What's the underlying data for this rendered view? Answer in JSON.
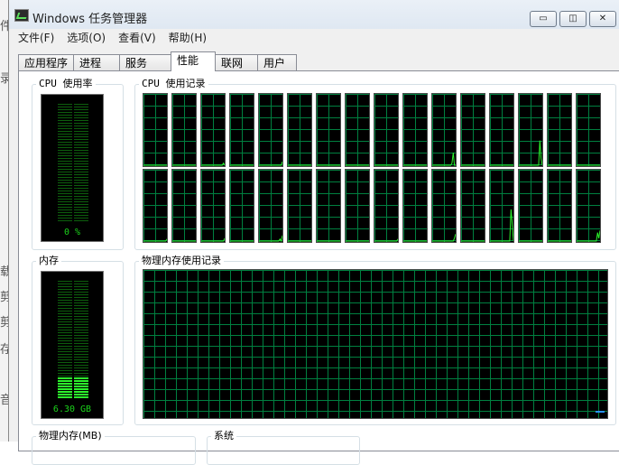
{
  "window": {
    "title": "Windows 任务管理器",
    "caption_buttons": {
      "minimize": "▭",
      "restore": "◫",
      "close": "✕"
    }
  },
  "menubar": {
    "items": [
      {
        "label": "文件(F)"
      },
      {
        "label": "选项(O)"
      },
      {
        "label": "查看(V)"
      },
      {
        "label": "帮助(H)"
      }
    ]
  },
  "tabs": [
    {
      "label": "应用程序",
      "active": false
    },
    {
      "label": "进程",
      "active": false
    },
    {
      "label": "服务",
      "active": false
    },
    {
      "label": "性能",
      "active": true
    },
    {
      "label": "联网",
      "active": false
    },
    {
      "label": "用户",
      "active": false
    }
  ],
  "performance": {
    "cpu_usage": {
      "label": "CPU 使用率",
      "value_text": "0 %",
      "level": 0.0
    },
    "cpu_history": {
      "label": "CPU 使用记录",
      "core_count": 16,
      "cores": [
        {
          "top": [
            0,
            0,
            0,
            0,
            0,
            0,
            0,
            0,
            0,
            0,
            0,
            0,
            0,
            0,
            0,
            0,
            0,
            0,
            0,
            0
          ],
          "bottom": [
            0,
            0,
            0,
            0,
            0,
            0,
            0,
            0,
            0,
            0,
            0,
            0,
            0,
            0,
            0,
            0,
            0,
            0,
            0,
            3
          ]
        },
        {
          "top": [
            0,
            0,
            0,
            0,
            0,
            0,
            0,
            0,
            0,
            0,
            0,
            0,
            0,
            0,
            0,
            0,
            0,
            0,
            0,
            0
          ],
          "bottom": [
            0,
            0,
            0,
            0,
            0,
            0,
            0,
            0,
            0,
            0,
            0,
            0,
            0,
            0,
            0,
            0,
            0,
            0,
            0,
            0
          ]
        },
        {
          "top": [
            0,
            0,
            0,
            0,
            0,
            0,
            0,
            0,
            0,
            0,
            0,
            0,
            0,
            0,
            0,
            0,
            0,
            0,
            3,
            0
          ],
          "bottom": [
            0,
            0,
            0,
            0,
            0,
            0,
            0,
            0,
            0,
            0,
            0,
            0,
            0,
            0,
            0,
            0,
            0,
            0,
            0,
            4
          ]
        },
        {
          "top": [
            0,
            0,
            0,
            0,
            0,
            0,
            0,
            0,
            0,
            0,
            0,
            0,
            0,
            0,
            0,
            0,
            0,
            0,
            0,
            0
          ],
          "bottom": [
            0,
            0,
            0,
            0,
            0,
            0,
            0,
            0,
            0,
            0,
            0,
            0,
            0,
            0,
            0,
            0,
            0,
            0,
            0,
            0
          ]
        },
        {
          "top": [
            0,
            0,
            0,
            0,
            0,
            0,
            0,
            0,
            0,
            0,
            0,
            0,
            0,
            0,
            0,
            0,
            0,
            0,
            0,
            5
          ],
          "bottom": [
            0,
            0,
            0,
            0,
            0,
            0,
            0,
            0,
            0,
            0,
            0,
            0,
            0,
            0,
            0,
            0,
            0,
            3,
            0,
            8
          ]
        },
        {
          "top": [
            0,
            0,
            0,
            0,
            0,
            0,
            0,
            0,
            0,
            0,
            0,
            0,
            0,
            0,
            0,
            0,
            0,
            0,
            0,
            0
          ],
          "bottom": [
            0,
            0,
            0,
            0,
            0,
            0,
            0,
            0,
            0,
            0,
            0,
            0,
            0,
            0,
            0,
            0,
            0,
            0,
            0,
            0
          ]
        },
        {
          "top": [
            0,
            0,
            0,
            0,
            0,
            0,
            0,
            0,
            0,
            0,
            0,
            0,
            0,
            0,
            0,
            0,
            0,
            0,
            0,
            0
          ],
          "bottom": [
            0,
            0,
            0,
            0,
            0,
            0,
            0,
            0,
            0,
            0,
            0,
            0,
            0,
            0,
            0,
            0,
            0,
            0,
            0,
            0
          ]
        },
        {
          "top": [
            0,
            0,
            0,
            0,
            0,
            0,
            0,
            0,
            0,
            0,
            0,
            0,
            0,
            0,
            0,
            0,
            0,
            0,
            0,
            0
          ],
          "bottom": [
            0,
            0,
            0,
            0,
            0,
            0,
            0,
            0,
            0,
            0,
            0,
            0,
            0,
            0,
            0,
            0,
            0,
            0,
            0,
            0
          ]
        },
        {
          "top": [
            0,
            0,
            0,
            0,
            0,
            0,
            0,
            0,
            0,
            0,
            0,
            0,
            0,
            0,
            0,
            0,
            0,
            0,
            0,
            0
          ],
          "bottom": [
            0,
            0,
            0,
            0,
            0,
            0,
            0,
            0,
            0,
            0,
            0,
            0,
            0,
            0,
            0,
            0,
            0,
            0,
            0,
            3
          ]
        },
        {
          "top": [
            0,
            0,
            0,
            0,
            0,
            0,
            0,
            0,
            0,
            0,
            0,
            0,
            0,
            0,
            0,
            0,
            0,
            0,
            0,
            0
          ],
          "bottom": [
            0,
            0,
            0,
            0,
            0,
            0,
            0,
            0,
            0,
            0,
            0,
            0,
            0,
            0,
            0,
            0,
            0,
            0,
            0,
            0
          ]
        },
        {
          "top": [
            0,
            0,
            0,
            0,
            0,
            0,
            0,
            0,
            0,
            0,
            0,
            0,
            0,
            0,
            0,
            0,
            3,
            18,
            0,
            0
          ],
          "bottom": [
            0,
            0,
            0,
            0,
            0,
            0,
            0,
            0,
            0,
            0,
            0,
            0,
            0,
            0,
            0,
            0,
            0,
            0,
            4,
            10
          ]
        },
        {
          "top": [
            0,
            0,
            0,
            0,
            0,
            0,
            0,
            0,
            0,
            0,
            0,
            0,
            0,
            0,
            0,
            0,
            0,
            0,
            0,
            0
          ],
          "bottom": [
            0,
            0,
            0,
            0,
            0,
            0,
            0,
            0,
            0,
            0,
            0,
            0,
            0,
            0,
            0,
            0,
            0,
            0,
            0,
            0
          ]
        },
        {
          "top": [
            0,
            0,
            0,
            0,
            0,
            0,
            0,
            0,
            0,
            0,
            0,
            0,
            0,
            0,
            0,
            0,
            0,
            0,
            0,
            0
          ],
          "bottom": [
            0,
            0,
            0,
            0,
            0,
            0,
            0,
            0,
            0,
            0,
            0,
            0,
            0,
            0,
            0,
            0,
            0,
            45,
            25,
            0
          ]
        },
        {
          "top": [
            0,
            0,
            0,
            0,
            0,
            0,
            0,
            0,
            0,
            0,
            0,
            0,
            0,
            0,
            0,
            0,
            0,
            35,
            10,
            0
          ],
          "bottom": [
            0,
            0,
            0,
            0,
            0,
            0,
            0,
            0,
            0,
            0,
            0,
            0,
            0,
            0,
            0,
            0,
            0,
            0,
            0,
            0
          ]
        },
        {
          "top": [
            0,
            0,
            0,
            0,
            0,
            0,
            0,
            0,
            0,
            0,
            0,
            0,
            0,
            0,
            0,
            0,
            0,
            0,
            0,
            0
          ],
          "bottom": [
            0,
            0,
            0,
            0,
            0,
            0,
            0,
            0,
            0,
            0,
            0,
            0,
            0,
            0,
            0,
            0,
            0,
            0,
            0,
            0
          ]
        },
        {
          "top": [
            0,
            0,
            0,
            0,
            0,
            0,
            0,
            0,
            0,
            0,
            0,
            0,
            0,
            0,
            0,
            0,
            0,
            0,
            0,
            0
          ],
          "bottom": [
            0,
            0,
            0,
            0,
            0,
            0,
            0,
            0,
            0,
            0,
            0,
            0,
            0,
            0,
            0,
            0,
            0,
            12,
            4,
            15
          ]
        }
      ]
    },
    "memory": {
      "label": "内存",
      "value_text": "6.30 GB",
      "level": 0.18
    },
    "memory_history": {
      "label": "物理内存使用记录",
      "level": 0.18
    },
    "physical_memory_section": {
      "label": "物理内存(MB)"
    },
    "system_section": {
      "label": "系统"
    }
  },
  "colors": {
    "graph_line": "#2cf22c",
    "grid_line": "#008040",
    "memory_marker": "#2a90ff"
  },
  "desktop_edge_glyphs": [
    "件",
    "录",
    "载",
    "剪",
    "剪",
    "存",
    "音"
  ]
}
